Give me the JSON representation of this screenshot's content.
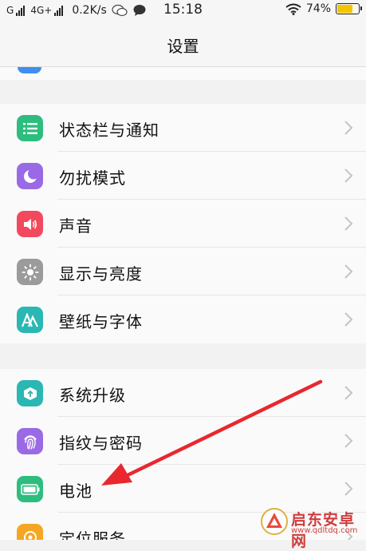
{
  "status_bar": {
    "carrier_1": "G",
    "carrier_2": "4G+",
    "speed": "0.2K/s",
    "time": "15:18",
    "battery": "74%",
    "battery_level": 0.74,
    "battery_color": "#f5c400"
  },
  "header": {
    "title": "设置"
  },
  "groups": [
    {
      "items": [
        {
          "label": "状态栏与通知",
          "icon": "notification-list-icon",
          "color": "#2dbd7e"
        },
        {
          "label": "勿扰模式",
          "icon": "moon-icon",
          "color": "#9a6ae6"
        },
        {
          "label": "声音",
          "icon": "speaker-icon",
          "color": "#f2495e"
        },
        {
          "label": "显示与亮度",
          "icon": "sun-icon",
          "color": "#9b9b9b"
        },
        {
          "label": "壁纸与字体",
          "icon": "font-a-icon",
          "color": "#2bb7b3"
        }
      ]
    },
    {
      "items": [
        {
          "label": "系统升级",
          "icon": "upgrade-box-icon",
          "color": "#2bb7b3"
        },
        {
          "label": "指纹与密码",
          "icon": "fingerprint-icon",
          "color": "#9a6ae6"
        },
        {
          "label": "电池",
          "icon": "battery-icon",
          "color": "#2dbd7e"
        },
        {
          "label": "定位服务",
          "icon": "location-icon",
          "color": "#f5a623"
        }
      ]
    }
  ],
  "annotation": {
    "color": "#e8282e"
  },
  "watermark": {
    "name": "启东安卓网",
    "url": "www.qdltdq.com"
  }
}
